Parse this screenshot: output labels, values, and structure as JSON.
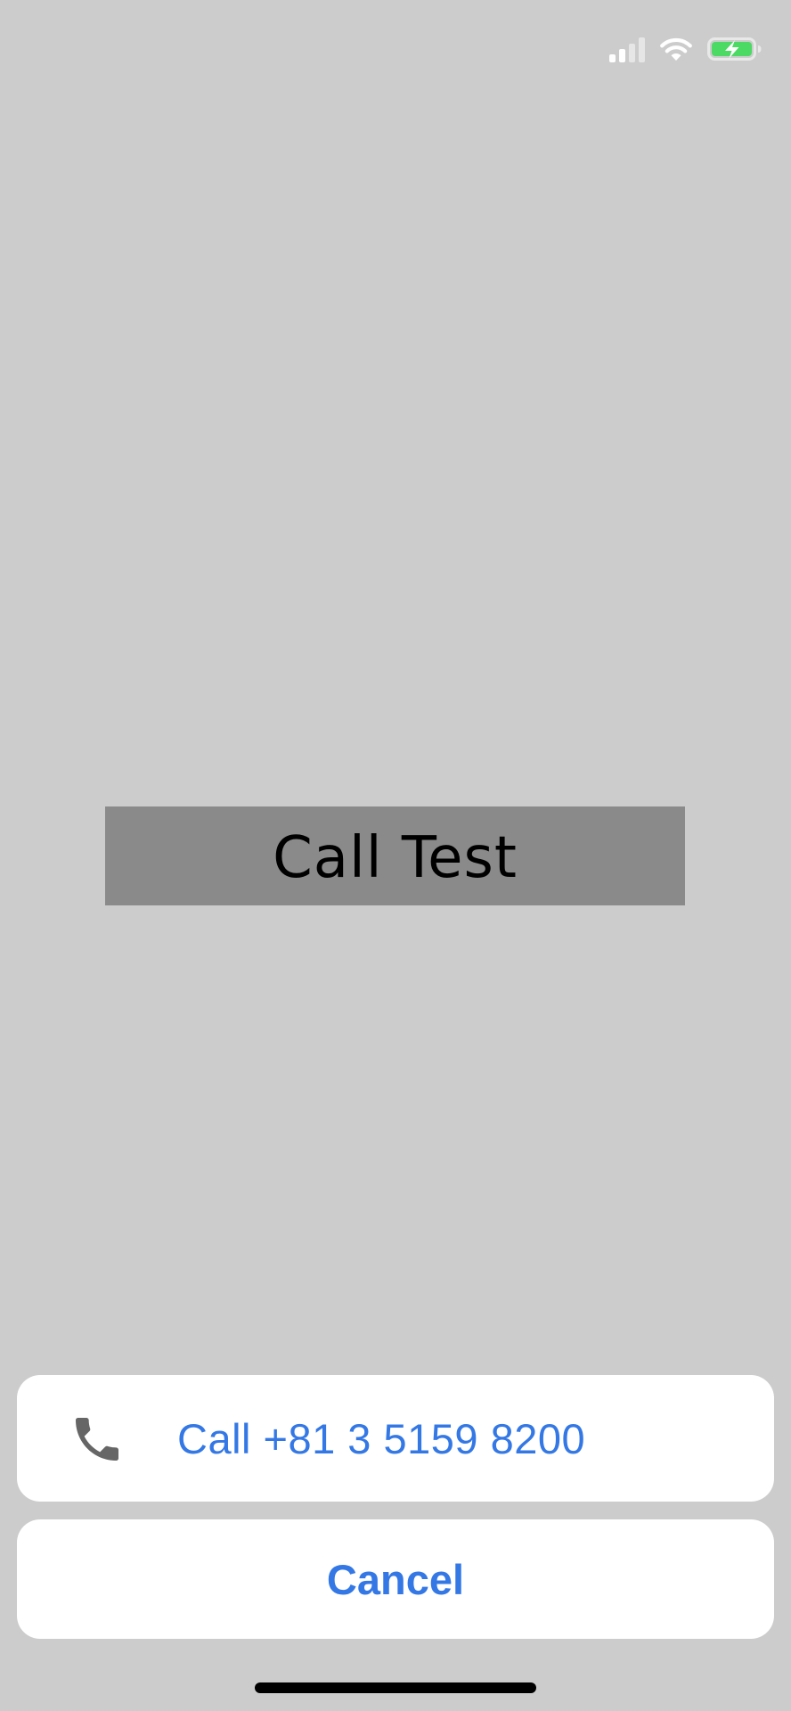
{
  "status_bar": {
    "signal_icon": "cellular-signal-icon",
    "wifi_icon": "wifi-icon",
    "battery_icon": "battery-charging-icon",
    "battery_color": "#4cd964"
  },
  "main": {
    "button_label": "Call Test",
    "button_color": "#8a8a8a"
  },
  "action_sheet": {
    "call_icon": "phone-icon",
    "call_label": "Call +81 3 5159 8200",
    "cancel_label": "Cancel",
    "accent_color": "#3478e5"
  }
}
